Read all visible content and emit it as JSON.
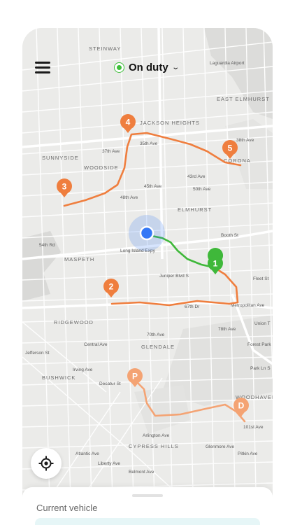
{
  "header": {
    "status_label": "On duty",
    "status_color": "#3fbf3a"
  },
  "icons": {
    "menu": "hamburger-menu-icon",
    "dropdown": "chevron-down-icon",
    "locate": "crosshair-icon"
  },
  "map": {
    "colors": {
      "route_orange": "#ef7e3e",
      "route_green": "#3fb83a",
      "pickup_pin": "#f4a373",
      "current_location": "#3478f6"
    },
    "stops": [
      {
        "label": "1",
        "color": "#3fb83a"
      },
      {
        "label": "2",
        "color": "#ef7e3e"
      },
      {
        "label": "3",
        "color": "#ef7e3e"
      },
      {
        "label": "4",
        "color": "#ef7e3e"
      },
      {
        "label": "5",
        "color": "#ef7e3e"
      },
      {
        "label": "P",
        "color": "#f4a373"
      },
      {
        "label": "D",
        "color": "#f4a373"
      }
    ],
    "labels": {
      "steinway": "STEINWAY",
      "laguardia": "Laguardia Airport",
      "east_elmhurst": "EAST ELMHURST",
      "jackson_heights": "JACKSON HEIGHTS",
      "sunnyside": "SUNNYSIDE",
      "woodside": "WOODSIDE",
      "corona": "CORONA",
      "elmhurst": "ELMHURST",
      "maspeth": "MASPETH",
      "ridgewood": "RIDGEWOOD",
      "glendale": "GLENDALE",
      "bushwick": "BUSHWICK",
      "cypress_hills": "CYPRESS HILLS",
      "woodhaven": "WOODHAVEN",
      "forest_park": "Forest Park",
      "long_island_exp": "Long Island Expy",
      "metropolitan_ave": "Metropolitan Ave",
      "st_54": "54th Rd",
      "ave_48": "48th Ave",
      "ave_67": "67th Dr",
      "ave_70": "70th Ave",
      "ave_78": "78th Ave",
      "ave_35": "35th Ave",
      "ave_37": "37th Ave",
      "ave_38": "38th Ave",
      "ave_43": "43rd Ave",
      "ave_45": "45th Ave",
      "ave_50": "50th Ave",
      "juniper": "Juniper Blvd S",
      "booth": "Booth St",
      "union_tpke": "Union T",
      "atlantic": "Atlantic Ave",
      "arlington": "Arlington Ave",
      "liberty": "Liberty Ave",
      "pitkin": "Pitkin Ave",
      "glenmore": "Glenmore Ave",
      "ave_101": "101st Ave",
      "belmont": "Belmont Ave",
      "fleet": "Fleet St",
      "park_ln": "Park Ln S",
      "jefferson": "Jefferson St",
      "irving": "Irving Ave",
      "decatur": "Decatur St",
      "central": "Central Ave"
    }
  },
  "sheet": {
    "title": "Current vehicle"
  }
}
